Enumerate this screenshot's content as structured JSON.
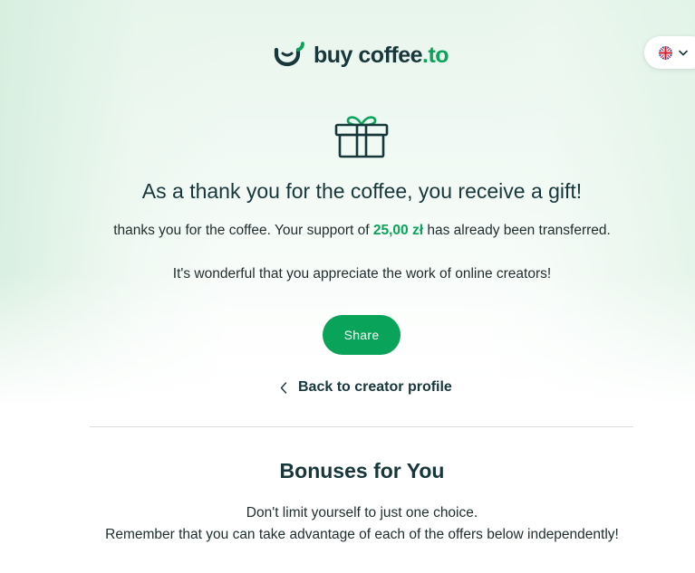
{
  "logo": {
    "brand": "buy coffee",
    "tld": ".to"
  },
  "language": {
    "current_flag": "uk-flag-icon"
  },
  "icons": {
    "gift": "gift-icon",
    "cup": "coffee-cup-icon",
    "back": "chevron-left-icon",
    "dropdown": "chevron-down-icon"
  },
  "colors": {
    "accent": "#0aa35a",
    "text_dark": "#17373a"
  },
  "thank_you": {
    "headline": "As a thank you for the coffee, you receive a gift!",
    "support_prefix": "thanks you for the coffee. Your support of",
    "amount": "25,00 zł",
    "support_suffix": "has already been transferred.",
    "appreciation": "It's wonderful that you appreciate the work of online creators!"
  },
  "actions": {
    "share_label": "Share",
    "back_label": "Back to creator profile"
  },
  "bonuses": {
    "title": "Bonuses for You",
    "line1": "Don't limit yourself to just one choice.",
    "line2": "Remember that you can take advantage of each of the offers below independently!"
  }
}
